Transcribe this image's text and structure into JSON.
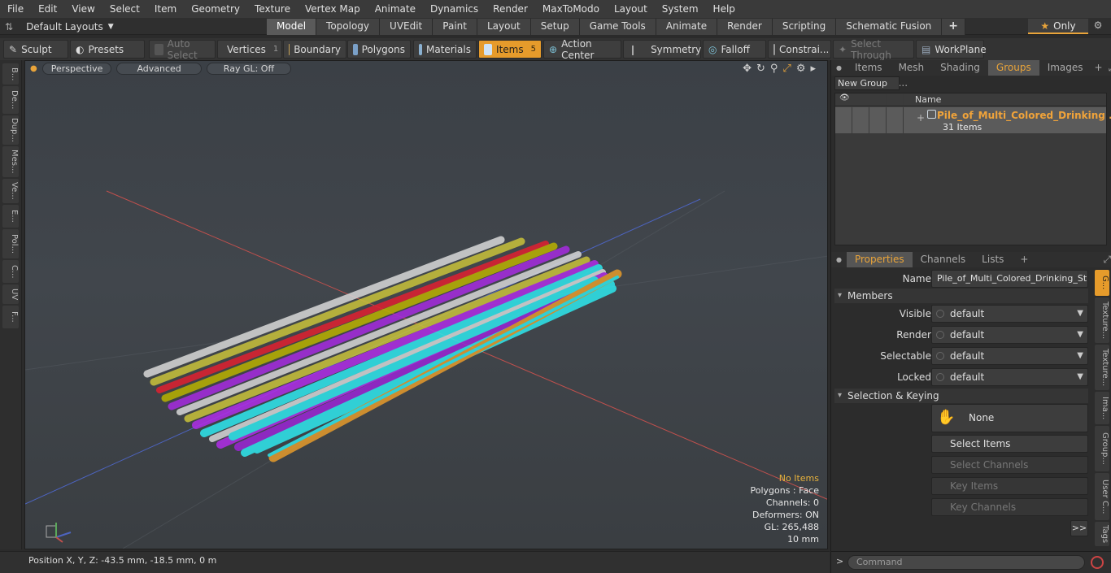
{
  "menu": [
    "File",
    "Edit",
    "View",
    "Select",
    "Item",
    "Geometry",
    "Texture",
    "Vertex Map",
    "Animate",
    "Dynamics",
    "Render",
    "MaxToModo",
    "Layout",
    "System",
    "Help"
  ],
  "layouts": {
    "label": "Default Layouts"
  },
  "tabs": [
    "Model",
    "Topology",
    "UVEdit",
    "Paint",
    "Layout",
    "Setup",
    "Game Tools",
    "Animate",
    "Render",
    "Scripting",
    "Schematic Fusion",
    "+"
  ],
  "only_label": "Only",
  "toolbar": {
    "sculpt": "Sculpt",
    "presets": "Presets",
    "auto_select": "Auto Select",
    "vertices": "Vertices",
    "vertices_count": "1",
    "boundary": "Boundary",
    "polygons": "Polygons",
    "materials": "Materials",
    "items": "Items",
    "items_count": "5",
    "action_center": "Action Center",
    "symmetry": "Symmetry",
    "falloff": "Falloff",
    "constraints": "Constrai...",
    "select_through": "Select Through",
    "workplane": "WorkPlane"
  },
  "left_tabs": [
    "B...",
    "De...",
    "Dup...",
    "Mes...",
    "Ve...",
    "E...",
    "Pol...",
    "C...",
    "UV",
    "F..."
  ],
  "viewport": {
    "perspective": "Perspective",
    "advanced": "Advanced",
    "raygl": "Ray GL: Off",
    "stats": {
      "no_items": "No Items",
      "polygons": "Polygons : Face",
      "channels": "Channels: 0",
      "deformers": "Deformers: ON",
      "gl": "GL: 265,488",
      "scale": "10 mm"
    }
  },
  "status": {
    "position": "Position X, Y, Z:  -43.5 mm, -18.5 mm, 0 m"
  },
  "top_tabs": [
    "Items",
    "Mesh ...",
    "Shading",
    "Groups",
    "Images",
    "+"
  ],
  "groups": {
    "new_group": "New Group",
    "name_header": "Name",
    "group_name": "Pile_of_Multi_Colored_Drinking ...",
    "group_count": "31 Items"
  },
  "prop_tabs": [
    "Properties",
    "Channels",
    "Lists",
    "+"
  ],
  "properties": {
    "name_label": "Name",
    "name_value": "Pile_of_Multi_Colored_Drinking_Straw",
    "members_label": "Members",
    "visible_label": "Visible",
    "visible_value": "default",
    "render_label": "Render",
    "render_value": "default",
    "selectable_label": "Selectable",
    "selectable_value": "default",
    "locked_label": "Locked",
    "locked_value": "default",
    "selkey_label": "Selection & Keying",
    "none_label": "None",
    "select_items": "Select Items",
    "select_channels": "Select Channels",
    "key_items": "Key Items",
    "key_channels": "Key Channels",
    "more": ">>"
  },
  "prop_vtabs": [
    "G...",
    "Texture...",
    "Texture...",
    "Ima...",
    "Group...",
    "User C...",
    "Tags"
  ],
  "command": {
    "placeholder": "Command"
  }
}
